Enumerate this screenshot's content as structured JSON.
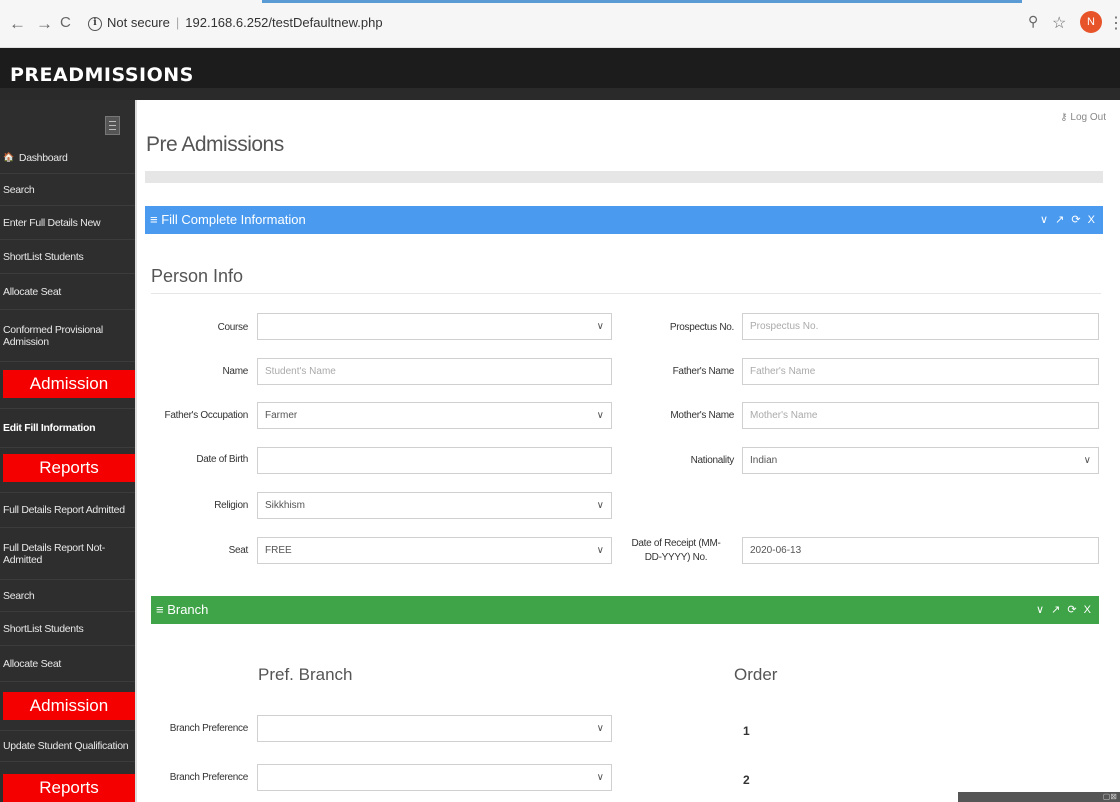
{
  "browser": {
    "nav_back": "←",
    "nav_forward": "→",
    "nav_reload": "C",
    "security": "Not secure",
    "url": "192.168.6.252/testDefaultnew.php",
    "avatar": "N"
  },
  "app": {
    "title": "PREADMISSIONS"
  },
  "sidebar": {
    "items": [
      {
        "label": "Dashboard"
      },
      {
        "label": "Search"
      },
      {
        "label": "Enter Full Details New"
      },
      {
        "label": "ShortList Students"
      },
      {
        "label": "Allocate Seat"
      },
      {
        "label": "Conformed Provisional Admission"
      },
      {
        "label": "Admission"
      },
      {
        "label": "Edit Fill Information"
      },
      {
        "label": "Reports"
      },
      {
        "label": "Full Details Report Admitted"
      },
      {
        "label": "Full Details Report Not-Admitted"
      },
      {
        "label": "Search"
      },
      {
        "label": "ShortList Students"
      },
      {
        "label": "Allocate Seat"
      },
      {
        "label": "Admission"
      },
      {
        "label": "Update Student Qualification"
      },
      {
        "label": "Reports"
      }
    ]
  },
  "main": {
    "logout": "Log Out",
    "page_title": "Pre Admissions",
    "panel1_title": "Fill Complete Information",
    "panel_tools": "∨ ↗ ⟳ X",
    "section_title": "Person Info",
    "form": {
      "course_label": "Course",
      "course_value": "",
      "name_label": "Name",
      "name_placeholder": "Student's Name",
      "fathers_occupation_label": "Father's Occupation",
      "fathers_occupation_value": "Farmer",
      "dob_label": "Date of Birth",
      "dob_value": "",
      "religion_label": "Religion",
      "religion_value": "Sikkhism",
      "seat_label": "Seat",
      "seat_value": "FREE",
      "prospectus_label": "Prospectus No.",
      "prospectus_placeholder": "Prospectus No.",
      "fathers_name_label": "Father's Name",
      "fathers_name_placeholder": "Father's Name",
      "mothers_name_label": "Mother's Name",
      "mothers_name_placeholder": "Mother's Name",
      "nationality_label": "Nationality",
      "nationality_value": "Indian",
      "receipt_label": "Date of Receipt (MM-DD-YYYY) No.",
      "receipt_value": "2020-06-13"
    },
    "panel2_title": "Branch",
    "branch": {
      "pref_header": "Pref. Branch",
      "order_header": "Order",
      "rows": [
        {
          "label": "Branch Preference",
          "value": "",
          "order": "1"
        },
        {
          "label": "Branch Preference",
          "value": "",
          "order": "2"
        }
      ]
    }
  }
}
